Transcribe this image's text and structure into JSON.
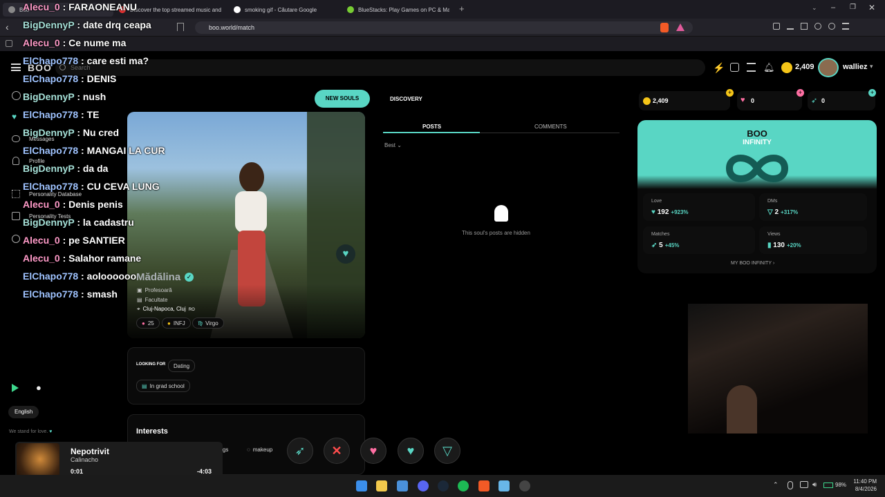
{
  "tabs": [
    {
      "label": "Boo"
    },
    {
      "label": "Discover the top streamed music and"
    },
    {
      "label": "smoking gif - Căutare Google"
    },
    {
      "label": "BlueStacks: Play Games on PC & Mac"
    }
  ],
  "address": {
    "url": "boo.world/match"
  },
  "header": {
    "logo": "BOO",
    "search_placeholder": "Search",
    "coins": "2,409",
    "username": "walliez"
  },
  "nav": {
    "items": [
      "Messages",
      "Profile",
      "Personality Database",
      "Personality Tests"
    ],
    "language": "English",
    "footer": "We stand for love."
  },
  "top_buttons": {
    "new_souls": "NEW SOULS",
    "discovery": "DISCOVERY"
  },
  "profile": {
    "name": "Mădălina",
    "job": "Profesoară",
    "education": "Facultate",
    "location": "Cluj-Napoca, Cluj",
    "country": "RO",
    "tags": [
      "25",
      "INFJ",
      "Virgo"
    ]
  },
  "looking_for": {
    "label": "LOOKING FOR",
    "value": "Dating",
    "tag": "In grad school"
  },
  "interests": {
    "title": "Interests",
    "items": [
      "dogs",
      "makeup"
    ]
  },
  "posts": {
    "tabs": [
      "POSTS",
      "COMMENTS"
    ],
    "sort": "Best",
    "hidden_msg": "This soul's posts are hidden"
  },
  "right": {
    "coins": "2,409",
    "love_count": "0",
    "boost_count": "0",
    "banner_title": "BOO",
    "banner_sub": "INFINITY",
    "stats": [
      {
        "label": "Love",
        "value": "192",
        "pct": "+923%"
      },
      {
        "label": "DMs",
        "value": "2",
        "pct": "+317%"
      },
      {
        "label": "Matches",
        "value": "5",
        "pct": "+45%"
      },
      {
        "label": "Views",
        "value": "130",
        "pct": "+20%"
      }
    ],
    "my_boo": "MY BOO INFINITY"
  },
  "chat": [
    {
      "user": "Alecu_0",
      "msg": "FARAONEANU"
    },
    {
      "user": "BigDennyP",
      "msg": "date drq ceapa"
    },
    {
      "user": "Alecu_0",
      "msg": "Ce nume ma"
    },
    {
      "user": "ElChapo778",
      "msg": "care esti ma?"
    },
    {
      "user": "ElChapo778",
      "msg": "DENIS"
    },
    {
      "user": "BigDennyP",
      "msg": "nush"
    },
    {
      "user": "ElChapo778",
      "msg": "TE"
    },
    {
      "user": "BigDennyP",
      "msg": "Nu cred"
    },
    {
      "user": "ElChapo778",
      "msg": "MANGAI LA CUR"
    },
    {
      "user": "BigDennyP",
      "msg": "da da"
    },
    {
      "user": "ElChapo778",
      "msg": "CU CEVA LUNG"
    },
    {
      "user": "Alecu_0",
      "msg": "Denis penis"
    },
    {
      "user": "BigDennyP",
      "msg": "la cadastru"
    },
    {
      "user": "Alecu_0",
      "msg": "pe SANTIER"
    },
    {
      "user": "Alecu_0",
      "msg": "Salahor ramane"
    },
    {
      "user": "ElChapo778",
      "msg": "aoloooooo"
    },
    {
      "user": "ElChapo778",
      "msg": "smash"
    }
  ],
  "music": {
    "title": "Nepotrivit",
    "artist": "Calinacho",
    "elapsed": "0:01",
    "remaining": "-4:03",
    "progress": 0.004
  },
  "tray": {
    "battery": "98%",
    "time": "11:40 PM",
    "date": "8/4/2026"
  },
  "colors": {
    "accent": "#59d6c4",
    "love": "#ff6fa3",
    "bg": "#000000"
  }
}
